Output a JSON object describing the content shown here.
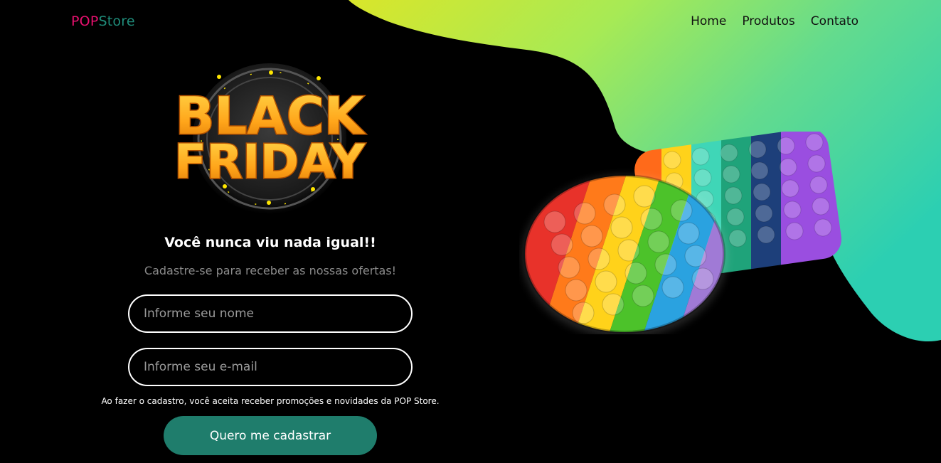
{
  "brand": {
    "part1": "POP",
    "part2": "Store"
  },
  "nav": {
    "items": [
      "Home",
      "Produtos",
      "Contato"
    ]
  },
  "hero": {
    "badge_line1": "BLACK",
    "badge_line2": "FRIDAY",
    "headline": "Você nunca viu nada igual!!",
    "subtitle": "Cadastre-se para receber as nossas ofertas!"
  },
  "form": {
    "name_placeholder": "Informe seu nome",
    "email_placeholder": "Informe seu e-mail",
    "terms": "Ao fazer o cadastro, você aceita receber promoções e novidades da POP Store.",
    "submit_label": "Quero me cadastrar"
  },
  "colors": {
    "brand_pink": "#e8106f",
    "brand_teal": "#1f8c7a",
    "button": "#1f7d6c",
    "gradient_start": "#d6e82a",
    "gradient_end": "#2ccfb2"
  }
}
